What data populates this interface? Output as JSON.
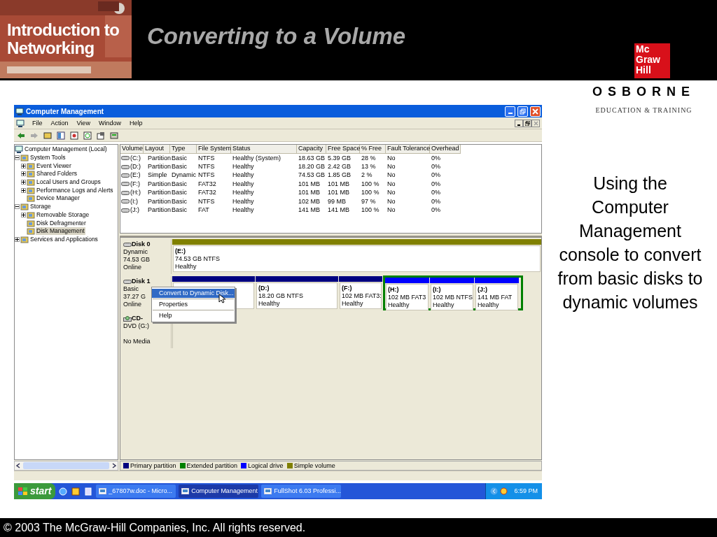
{
  "slide": {
    "logo_text": [
      "Introduction to",
      "Networking"
    ],
    "title": "Converting to a Volume",
    "publisher_mark": [
      "Mc",
      "Graw",
      "Hill"
    ],
    "publisher_name": "OSBORNE",
    "publisher_tagline": "EDUCATION & TRAINING",
    "caption": "Using the Computer Management console to convert from basic disks to dynamic volumes",
    "footer": "© 2003 The McGraw-Hill Companies, Inc. All rights reserved."
  },
  "window": {
    "title": "Computer Management",
    "menu": [
      "File",
      "Action",
      "View",
      "Window",
      "Help"
    ]
  },
  "tree": [
    {
      "label": "Computer Management (Local)",
      "selected": false,
      "children": [
        {
          "label": "System Tools",
          "expanded": true,
          "selected": false,
          "children": [
            {
              "label": "Event Viewer",
              "expanded": false,
              "selected": false
            },
            {
              "label": "Shared Folders",
              "expanded": false,
              "selected": false
            },
            {
              "label": "Local Users and Groups",
              "expanded": false,
              "selected": false
            },
            {
              "label": "Performance Logs and Alerts",
              "expanded": false,
              "selected": false
            },
            {
              "label": "Device Manager",
              "selected": false
            }
          ]
        },
        {
          "label": "Storage",
          "expanded": true,
          "selected": false,
          "children": [
            {
              "label": "Removable Storage",
              "expanded": false,
              "selected": false
            },
            {
              "label": "Disk Defragmenter",
              "selected": false
            },
            {
              "label": "Disk Management",
              "selected": true
            }
          ]
        },
        {
          "label": "Services and Applications",
          "expanded": false,
          "selected": false
        }
      ]
    }
  ],
  "table": {
    "columns": [
      "Volume",
      "Layout",
      "Type",
      "File System",
      "Status",
      "Capacity",
      "Free Space",
      "% Free",
      "Fault Tolerance",
      "Overhead"
    ],
    "rows": [
      [
        "(C:)",
        "Partition",
        "Basic",
        "NTFS",
        "Healthy (System)",
        "18.63 GB",
        "5.39 GB",
        "28 %",
        "No",
        "0%"
      ],
      [
        "(D:)",
        "Partition",
        "Basic",
        "NTFS",
        "Healthy",
        "18.20 GB",
        "2.42 GB",
        "13 %",
        "No",
        "0%"
      ],
      [
        "(E:)",
        "Simple",
        "Dynamic",
        "NTFS",
        "Healthy",
        "74.53 GB",
        "1.85 GB",
        "2 %",
        "No",
        "0%"
      ],
      [
        "(F:)",
        "Partition",
        "Basic",
        "FAT32",
        "Healthy",
        "101 MB",
        "101 MB",
        "100 %",
        "No",
        "0%"
      ],
      [
        "(H:)",
        "Partition",
        "Basic",
        "FAT32",
        "Healthy",
        "101 MB",
        "101 MB",
        "100 %",
        "No",
        "0%"
      ],
      [
        "(I:)",
        "Partition",
        "Basic",
        "NTFS",
        "Healthy",
        "102 MB",
        "99 MB",
        "97 %",
        "No",
        "0%"
      ],
      [
        "(J:)",
        "Partition",
        "Basic",
        "FAT",
        "Healthy",
        "141 MB",
        "141 MB",
        "100 %",
        "No",
        "0%"
      ]
    ]
  },
  "disks": [
    {
      "kind": "disk",
      "name": "Disk 0",
      "lines": [
        "Dynamic",
        "74.53 GB",
        "Online"
      ],
      "partitions": [
        {
          "kind": "simple",
          "letter": "(E:)",
          "detail": "74.53 GB NTFS",
          "status": "Healthy"
        }
      ]
    },
    {
      "kind": "disk",
      "name": "Disk 1",
      "lines": [
        "Basic",
        "37.27 G",
        "Online"
      ],
      "partitions": [
        {
          "kind": "primary"
        },
        {
          "kind": "primary",
          "letter": "(D:)",
          "detail": "18.20 GB NTFS",
          "status": "Healthy"
        },
        {
          "kind": "primary",
          "letter": "(F:)",
          "detail": "102 MB FAT3:",
          "status": "Healthy"
        },
        {
          "kind": "extended",
          "children": [
            {
              "kind": "logical",
              "letter": "(H:)",
              "detail": "102 MB FAT3",
              "status": "Healthy"
            },
            {
              "kind": "logical",
              "letter": "(I:)",
              "detail": "102 MB NTFS",
              "status": "Healthy"
            },
            {
              "kind": "logical",
              "letter": "(J:)",
              "detail": "141 MB FAT",
              "status": "Healthy"
            }
          ]
        }
      ]
    },
    {
      "kind": "cdrom",
      "name": "CD-",
      "lines": [
        "DVD (G:)"
      ],
      "status": "No Media"
    }
  ],
  "legend": [
    {
      "label": "Primary partition",
      "color": "#000080"
    },
    {
      "label": "Extended partition",
      "color": "#008000"
    },
    {
      "label": "Logical drive",
      "color": "#0000ff"
    },
    {
      "label": "Simple volume",
      "color": "#808000"
    }
  ],
  "context_menu": [
    {
      "label": "Convert to Dynamic Disk...",
      "selected": true
    },
    {
      "label": "Properties",
      "selected": false
    },
    {
      "label": "Help",
      "selected": false
    }
  ],
  "taskbar": {
    "start": "start",
    "tasks": [
      {
        "label": "_67807w.doc - Micro...",
        "selected": false
      },
      {
        "label": "Computer Management",
        "selected": true
      },
      {
        "label": "FullShot 6.03 Professi...",
        "selected": false
      }
    ],
    "clock": "6:59 PM"
  }
}
